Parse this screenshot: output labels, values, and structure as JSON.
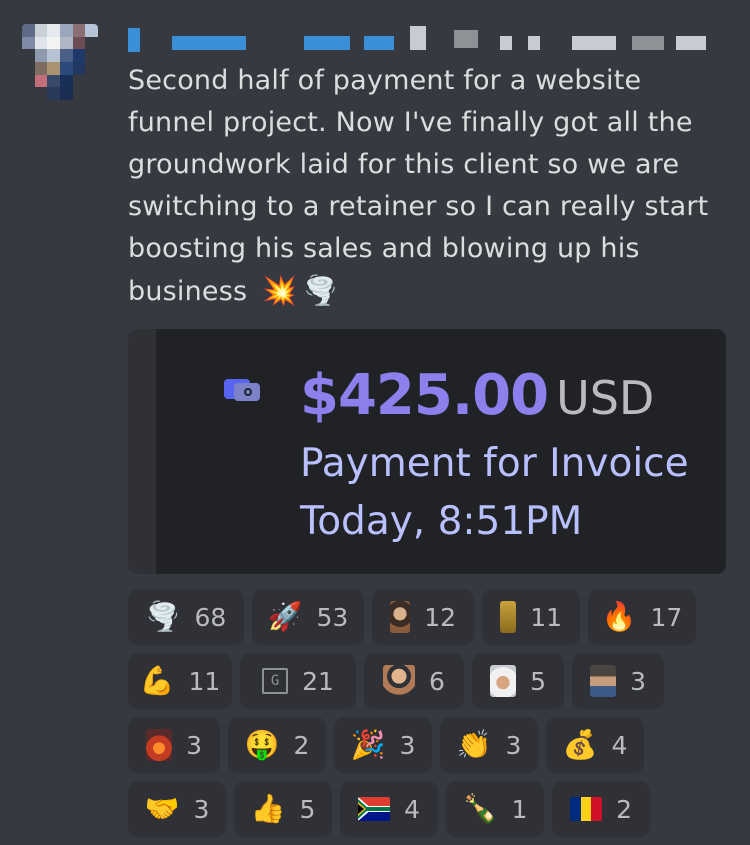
{
  "message": {
    "text": "Second half of payment for a website funnel project. Now I've finally got all the groundwork laid for this client so we are switching to a retainer so I can really start boosting his sales and blowing up his business",
    "trailing_emojis": [
      "💥",
      "🌪️"
    ]
  },
  "payment": {
    "amount": "$425.00",
    "currency": "USD",
    "label": "Payment for Invoice",
    "time": "Today, 8:51PM",
    "icon": "wallet-icon"
  },
  "reactions": [
    [
      {
        "emoji": "🌪️",
        "count": "68",
        "icon": "tornado-icon"
      },
      {
        "emoji": "🚀",
        "count": "53",
        "icon": "rocket-icon"
      },
      {
        "emoji": "",
        "count": "12",
        "icon": "custom-face-icon"
      },
      {
        "emoji": "",
        "count": "11",
        "icon": "custom-trophy-icon"
      },
      {
        "emoji": "🔥",
        "count": "17",
        "icon": "fire-icon"
      }
    ],
    [
      {
        "emoji": "💪",
        "count": "11",
        "icon": "flexed-biceps-icon"
      },
      {
        "emoji": "G",
        "count": "21",
        "icon": "custom-g-icon"
      },
      {
        "emoji": "",
        "count": "6",
        "icon": "custom-bald-man-icon"
      },
      {
        "emoji": "",
        "count": "5",
        "icon": "custom-sheikh-icon"
      },
      {
        "emoji": "",
        "count": "3",
        "icon": "custom-hat-man-icon"
      }
    ],
    [
      {
        "emoji": "",
        "count": "3",
        "icon": "custom-explosion-icon"
      },
      {
        "emoji": "🤑",
        "count": "2",
        "icon": "money-mouth-face-icon"
      },
      {
        "emoji": "🎉",
        "count": "3",
        "icon": "party-popper-icon"
      },
      {
        "emoji": "👏",
        "count": "3",
        "icon": "clapping-hands-icon"
      },
      {
        "emoji": "💰",
        "count": "4",
        "icon": "money-bag-icon"
      }
    ],
    [
      {
        "emoji": "🤝",
        "count": "3",
        "icon": "handshake-icon"
      },
      {
        "emoji": "👍",
        "count": "5",
        "icon": "thumbs-up-icon"
      },
      {
        "emoji": "",
        "count": "4",
        "icon": "flag-south-africa-icon"
      },
      {
        "emoji": "🍾",
        "count": "1",
        "icon": "champagne-icon"
      },
      {
        "emoji": "",
        "count": "2",
        "icon": "flag-romania-icon"
      }
    ]
  ],
  "colors": {
    "background": "#36393f",
    "card_inner": "#202225",
    "amount": "#8b80ec",
    "payment_text": "#b9c0ff",
    "reaction_bg": "#2f3136"
  }
}
